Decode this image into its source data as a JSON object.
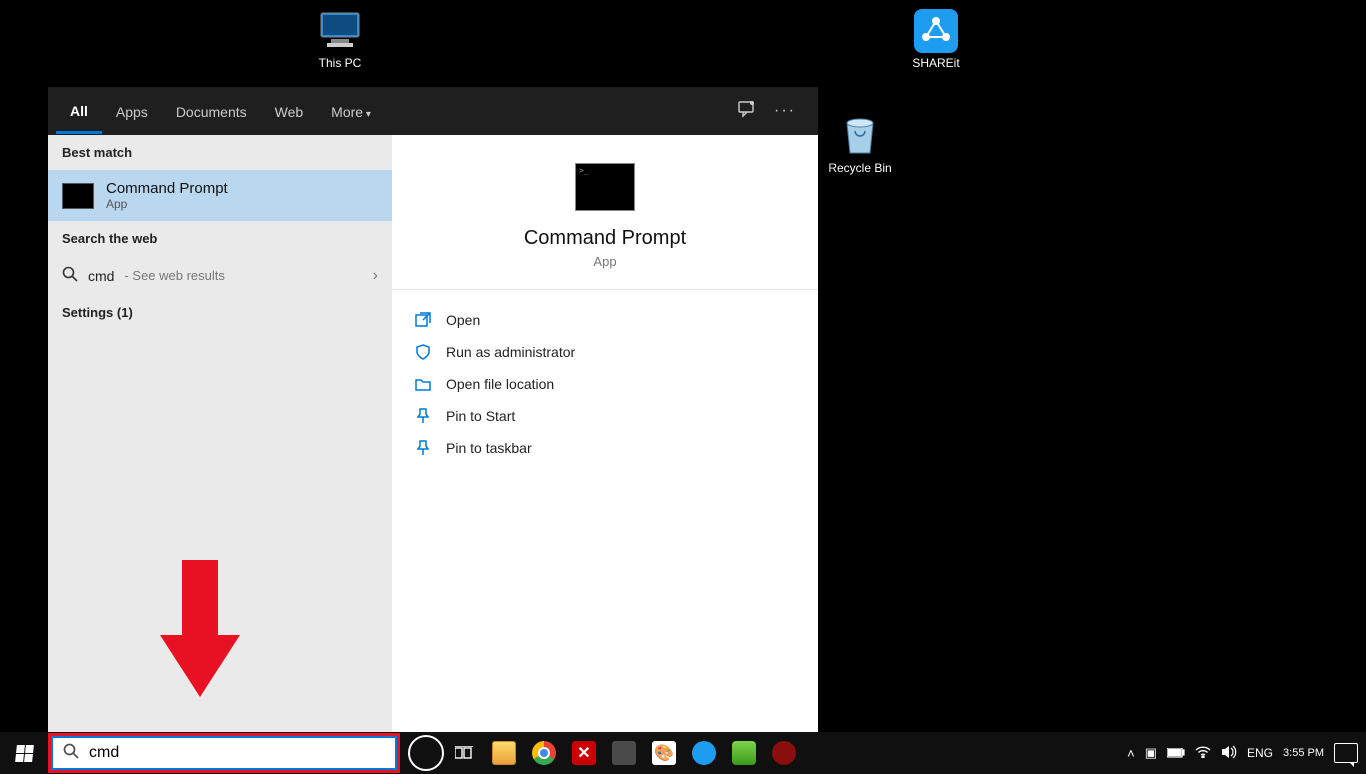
{
  "desktop": {
    "thispc": "This PC",
    "shareit": "SHAREit",
    "recycle": "Recycle Bin"
  },
  "tabs": {
    "all": "All",
    "apps": "Apps",
    "documents": "Documents",
    "web": "Web",
    "more": "More"
  },
  "sections": {
    "best_match": "Best match",
    "search_web": "Search the web",
    "settings": "Settings (1)"
  },
  "best_match": {
    "title": "Command Prompt",
    "subtitle": "App"
  },
  "web_result": {
    "query": "cmd",
    "hint": " - See web results"
  },
  "preview": {
    "title": "Command Prompt",
    "subtitle": "App"
  },
  "actions": {
    "open": "Open",
    "run_admin": "Run as administrator",
    "open_loc": "Open file location",
    "pin_start": "Pin to Start",
    "pin_taskbar": "Pin to taskbar"
  },
  "search": {
    "value": "cmd"
  },
  "tray": {
    "lang": "ENG",
    "time": "3:55 PM"
  }
}
